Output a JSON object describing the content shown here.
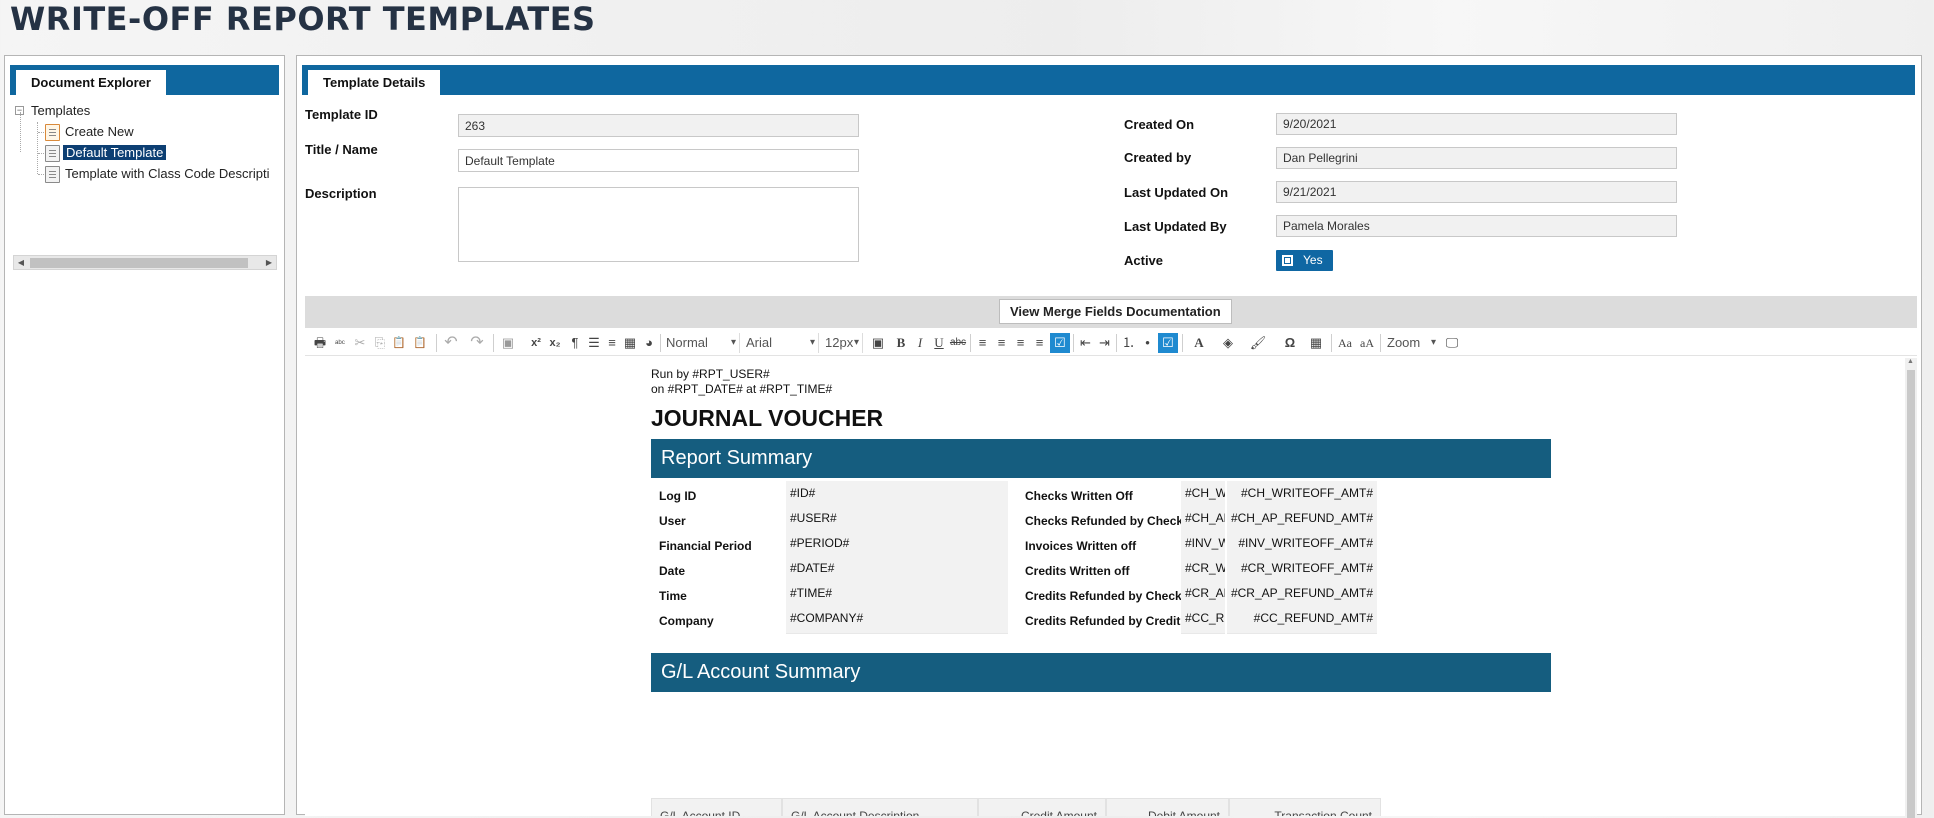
{
  "page": {
    "title": "WRITE-OFF REPORT TEMPLATES"
  },
  "explorer": {
    "tab": "Document Explorer",
    "root": "Templates",
    "toggle": "−",
    "items": [
      {
        "label": "Create New"
      },
      {
        "label": "Default Template",
        "selected": true
      },
      {
        "label": "Template with Class Code Descripti"
      }
    ],
    "scroll_left": "◀",
    "scroll_right": "▶"
  },
  "details": {
    "tab": "Template Details",
    "template_id_label": "Template ID",
    "template_id": "263",
    "title_label": "Title / Name",
    "title": "Default Template",
    "description_label": "Description",
    "description": "",
    "created_on_label": "Created On",
    "created_on": "9/20/2021",
    "created_by_label": "Created by",
    "created_by": "Dan Pellegrini",
    "last_updated_on_label": "Last Updated On",
    "last_updated_on": "9/21/2021",
    "last_updated_by_label": "Last Updated By",
    "last_updated_by": "Pamela Morales",
    "active_label": "Active",
    "active_value": "Yes"
  },
  "editor": {
    "merge_button": "View Merge Fields Documentation",
    "style_select": "Normal",
    "font_select": "Arial",
    "size_select": "12px",
    "zoom_select": "Zoom",
    "toolbar_icons": [
      "print-icon",
      "spellcheck-icon",
      "cut-icon",
      "copy-icon",
      "paste-icon",
      "paste-options-icon",
      "undo-icon",
      "redo-icon",
      "image-icon",
      "superscript-icon",
      "subscript-icon",
      "paragraph-icon",
      "list-style-icon",
      "align-icon",
      "table-props-icon",
      "pie-chart-icon"
    ],
    "glyphs": {
      "print": "🖶",
      "spell": "ᵃᵇᶜ",
      "cut": "✂",
      "copy": "⎘",
      "paste": "📋",
      "undo": "↶",
      "redo": "↷",
      "image": "▣",
      "sup": "x²",
      "sub": "x₂",
      "para": "¶",
      "list": "☰",
      "chart": "◕",
      "bold": "B",
      "italic": "I",
      "underline": "U",
      "strike": "abc",
      "align": "≡",
      "indent": "⇥",
      "outdent": "⇤",
      "ol": "⒈",
      "ul": "•",
      "check": "☑",
      "font_color": "A",
      "highlight": "◈",
      "brush": "🖌",
      "omega": "Ω",
      "table": "▦",
      "case_upper": "Aa",
      "case_lower": "aA",
      "preview": "🖵"
    }
  },
  "document": {
    "run_by": "Run by #RPT_USER#",
    "run_on": "on #RPT_DATE# at #RPT_TIME#",
    "heading": "JOURNAL VOUCHER",
    "summary_title": "Report Summary",
    "left_rows": [
      {
        "label": "Log ID",
        "value": "#ID#"
      },
      {
        "label": "User",
        "value": "#USER#"
      },
      {
        "label": "Financial Period",
        "value": "#PERIOD#"
      },
      {
        "label": "Date",
        "value": "#DATE#"
      },
      {
        "label": "Time",
        "value": "#TIME#"
      },
      {
        "label": "Company",
        "value": "#COMPANY#"
      }
    ],
    "right_rows": [
      {
        "label": "Checks Written Off",
        "code": "#CH_WR",
        "amount": "#CH_WRITEOFF_AMT#"
      },
      {
        "label": "Checks Refunded by Check",
        "code": "#CH_AP_",
        "amount": "#CH_AP_REFUND_AMT#"
      },
      {
        "label": "Invoices Written off",
        "code": "#INV_WF",
        "amount": "#INV_WRITEOFF_AMT#"
      },
      {
        "label": "Credits Written off",
        "code": "#CR_WR",
        "amount": "#CR_WRITEOFF_AMT#"
      },
      {
        "label": "Credits Refunded by Check",
        "code": "#CR_AP_",
        "amount": "#CR_AP_REFUND_AMT#"
      },
      {
        "label": "Credits Refunded by Credit Card",
        "code": "#CC_REI",
        "amount": "#CC_REFUND_AMT#"
      }
    ],
    "gl_title": "G/L Account Summary",
    "gl_columns": [
      "G/L Account ID",
      "G/L Account Description",
      "Credit Amount",
      "Debit Amount",
      "Transaction Count"
    ]
  }
}
